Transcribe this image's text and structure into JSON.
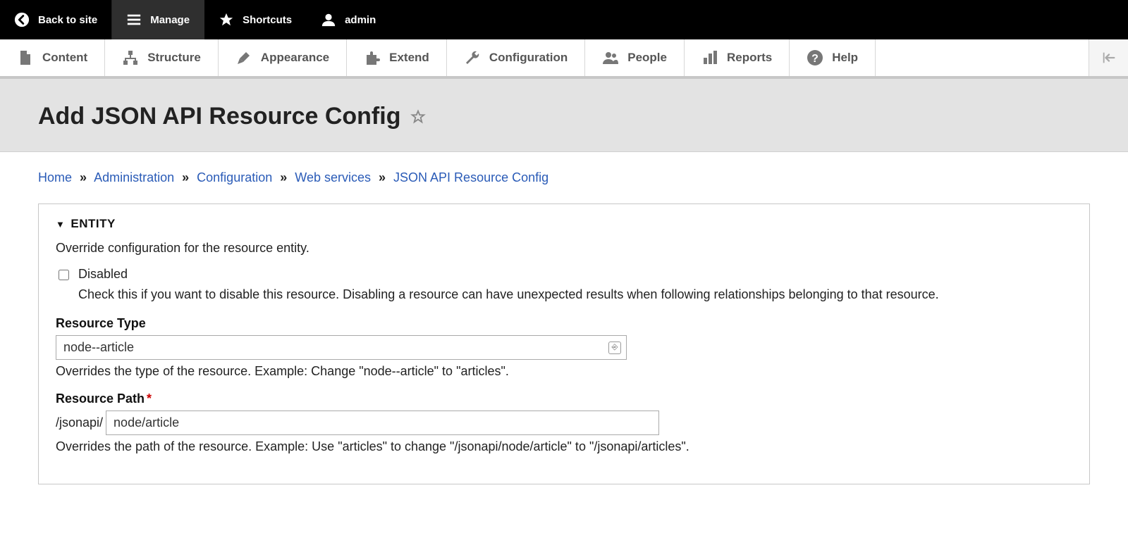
{
  "toolbar": {
    "back_label": "Back to site",
    "manage_label": "Manage",
    "shortcuts_label": "Shortcuts",
    "user_label": "admin"
  },
  "adminbar": {
    "content": "Content",
    "structure": "Structure",
    "appearance": "Appearance",
    "extend": "Extend",
    "configuration": "Configuration",
    "people": "People",
    "reports": "Reports",
    "help": "Help"
  },
  "page": {
    "title": "Add JSON API Resource Config"
  },
  "breadcrumb": {
    "home": "Home",
    "admin": "Administration",
    "config": "Configuration",
    "web": "Web services",
    "jsonapi": "JSON API Resource Config"
  },
  "fieldset": {
    "legend": "ENTITY",
    "desc": "Override configuration for the resource entity.",
    "disabled": {
      "label": "Disabled",
      "help": "Check this if you want to disable this resource. Disabling a resource can have unexpected results when following relationships belonging to that resource."
    },
    "resource_type": {
      "label": "Resource Type",
      "value": "node--article",
      "help": "Overrides the type of the resource. Example: Change \"node--article\" to \"articles\"."
    },
    "resource_path": {
      "label": "Resource Path",
      "prefix": "/jsonapi/",
      "value": "node/article",
      "help": "Overrides the path of the resource. Example: Use \"articles\" to change \"/jsonapi/node/article\" to \"/jsonapi/articles\"."
    }
  }
}
